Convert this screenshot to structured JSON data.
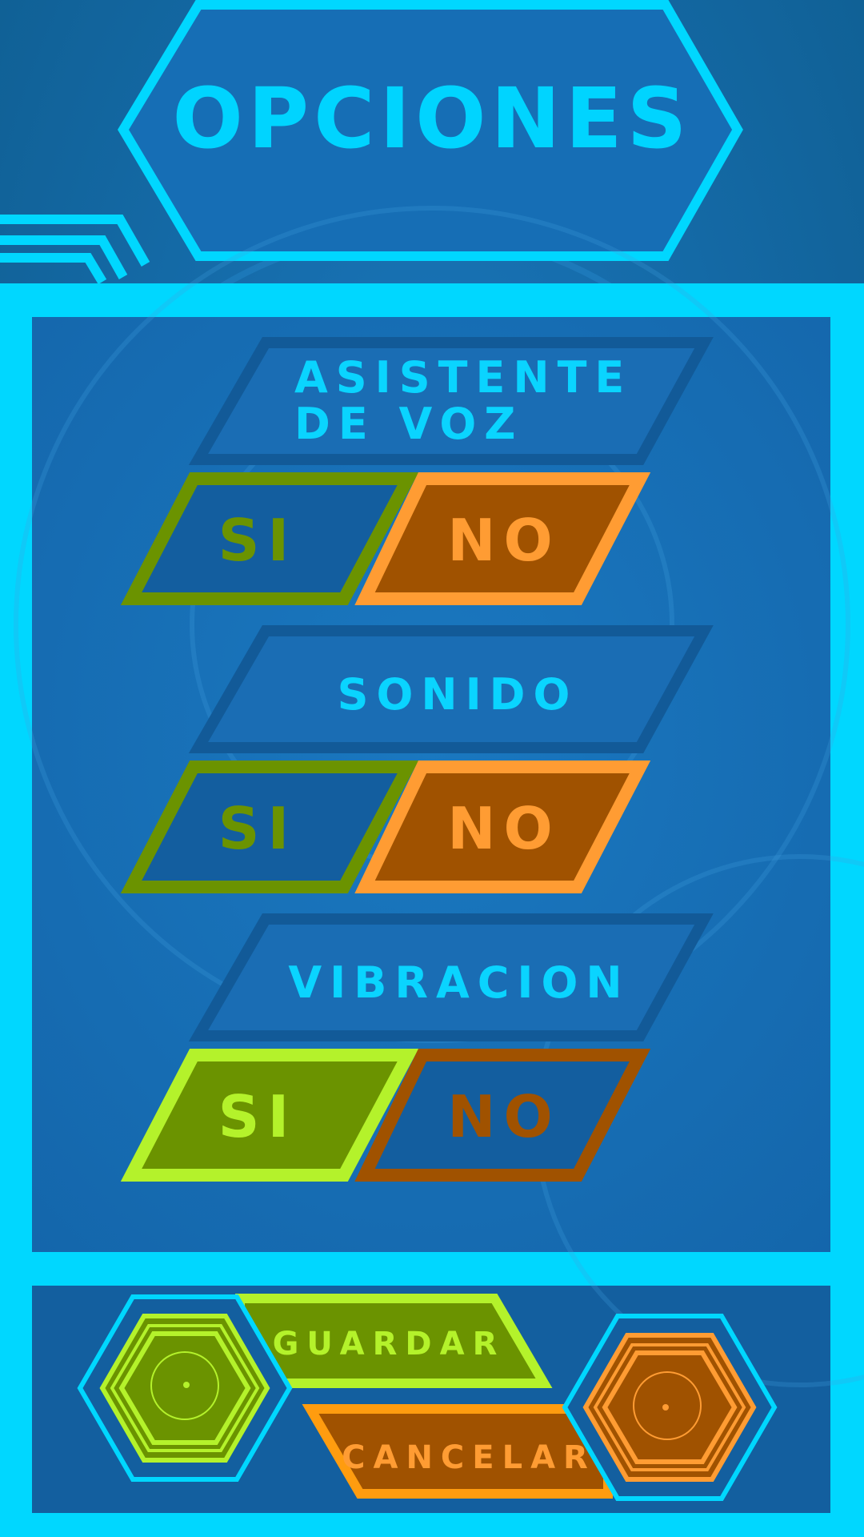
{
  "screen": {
    "title": "OPCIONES"
  },
  "options": [
    {
      "label_lines": [
        "ASISTENTE",
        "DE VOZ"
      ],
      "yes_label": "SI",
      "no_label": "NO",
      "selected": "no"
    },
    {
      "label_lines": [
        "SONIDO"
      ],
      "yes_label": "SI",
      "no_label": "NO",
      "selected": "no"
    },
    {
      "label_lines": [
        "VIBRACION"
      ],
      "yes_label": "SI",
      "no_label": "NO",
      "selected": "si"
    }
  ],
  "footer": {
    "save_label": "GUARDAR",
    "cancel_label": "CANCELAR",
    "left_icon": "hexagon-target-icon",
    "right_icon": "hexagon-target-icon"
  },
  "colors": {
    "background": "#0f5f8e",
    "panel_frame": "#00d7ff",
    "panel_fill": "#166eb5",
    "label_text": "#0ad4ff",
    "yes_green": "#6b9300",
    "yes_green_light": "#b4f22b",
    "no_orange": "#a05200",
    "no_orange_light": "#ff9c33"
  }
}
